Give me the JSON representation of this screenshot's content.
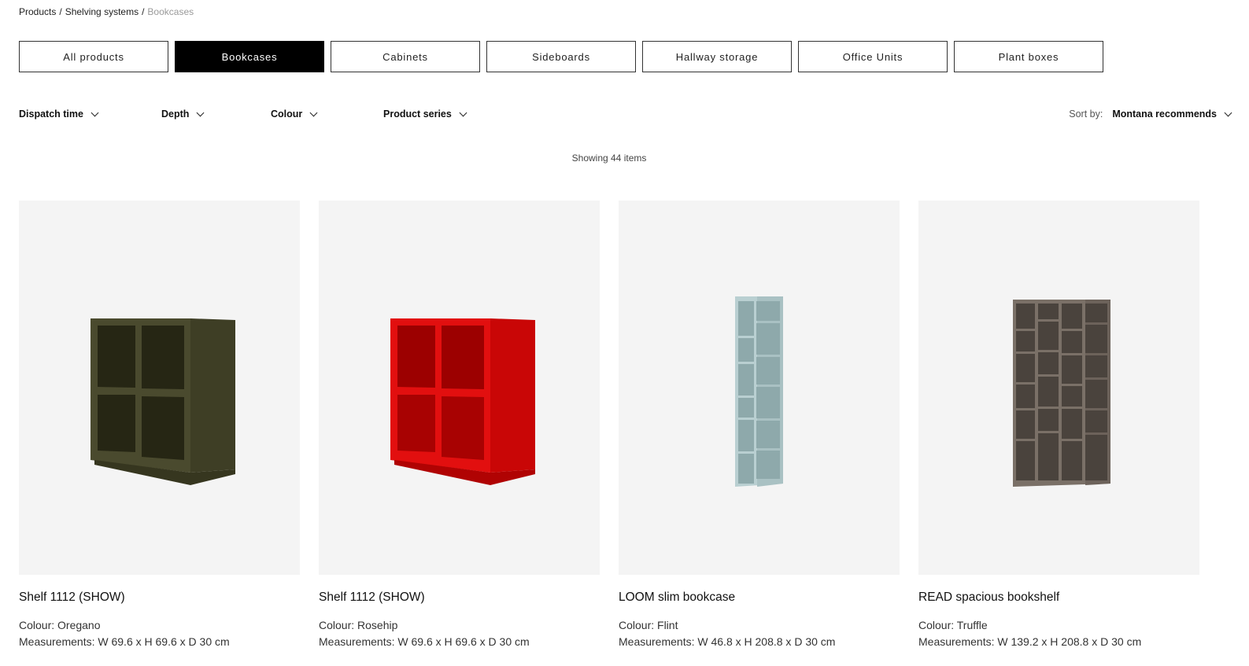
{
  "breadcrumb": {
    "products": "Products",
    "shelving": "Shelving systems",
    "current": "Bookcases",
    "separator": "/"
  },
  "tabs": [
    "All products",
    "Bookcases",
    "Cabinets",
    "Sideboards",
    "Hallway storage",
    "Office Units",
    "Plant boxes"
  ],
  "active_tab": "Bookcases",
  "filters": {
    "dispatch": "Dispatch time",
    "depth": "Depth",
    "colour": "Colour",
    "series": "Product series"
  },
  "sort": {
    "label": "Sort by:",
    "value": "Montana recommends"
  },
  "count_text": "Showing 44 items",
  "products": [
    {
      "name": "Shelf 1112 (SHOW)",
      "colour": "Colour: Oregano",
      "measurements": "Measurements: W 69.6 x H 69.6 x D 30 cm",
      "swatch": "#4a4a2e"
    },
    {
      "name": "Shelf 1112 (SHOW)",
      "colour": "Colour: Rosehip",
      "measurements": "Measurements: W 69.6 x H 69.6 x D 30 cm",
      "swatch": "#d40a0a"
    },
    {
      "name": "LOOM slim bookcase",
      "colour": "Colour: Flint",
      "measurements": "Measurements: W 46.8 x H 208.8 x D 30 cm",
      "swatch": "#b9cfd1"
    },
    {
      "name": "READ spacious bookshelf",
      "colour": "Colour: Truffle",
      "measurements": "Measurements: W 139.2 x H 208.8 x D 30 cm",
      "swatch": "#7a7067"
    }
  ]
}
